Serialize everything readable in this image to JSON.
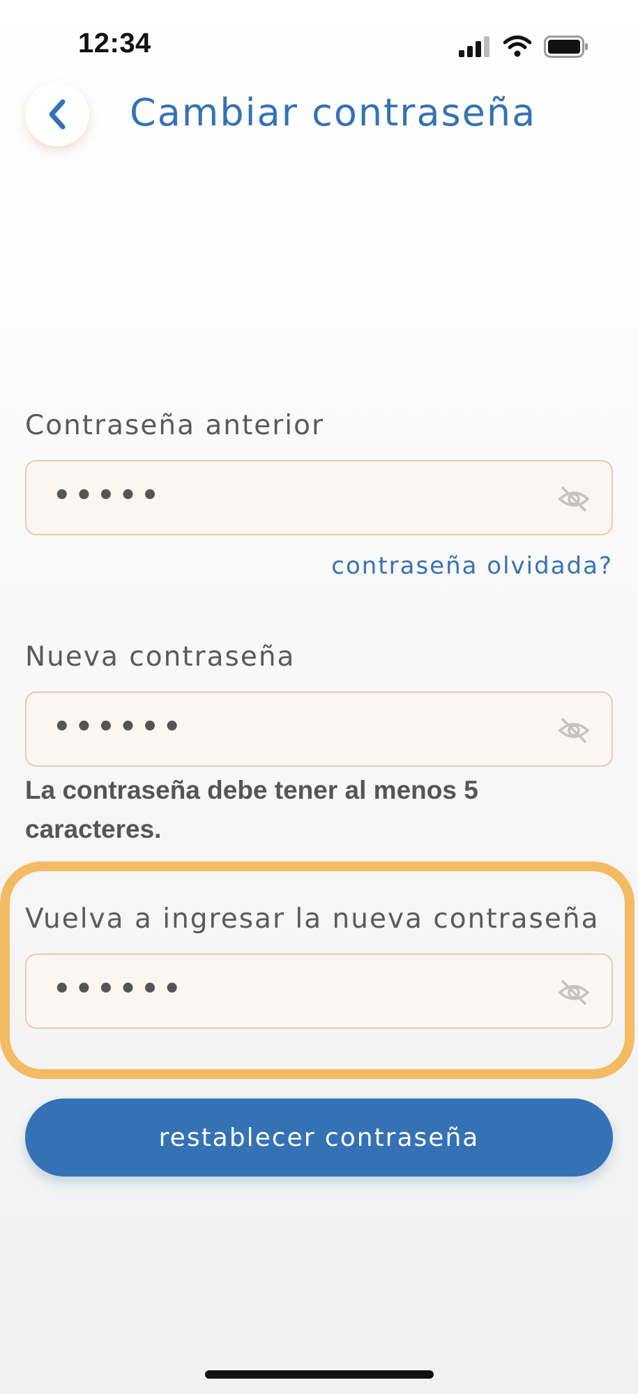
{
  "status_bar": {
    "time": "12:34",
    "icons": [
      "cellular-signal-icon",
      "wifi-icon",
      "battery-icon"
    ]
  },
  "header": {
    "back_icon": "chevron-left-icon",
    "title": "Cambiar contraseña"
  },
  "form": {
    "old_password": {
      "label": "Contraseña anterior",
      "value_masked": "•••••",
      "visibility_icon": "eye-slash-icon"
    },
    "forgot_link": "contraseña olvidada?",
    "new_password": {
      "label": "Nueva contraseña",
      "value_masked": "••••••",
      "visibility_icon": "eye-slash-icon"
    },
    "hint": "La contraseña debe tener al menos 5 caracteres.",
    "confirm_password": {
      "label": "Vuelva a ingresar la nueva contraseña",
      "value_masked": "••••••",
      "visibility_icon": "eye-slash-icon"
    },
    "submit_label": "restablecer contraseña"
  },
  "colors": {
    "accent": "#3572b5",
    "highlight": "#f3bb62",
    "field_bg": "#fbf6ef",
    "field_border": "#e1cdb2",
    "label_text": "#5a5a5a"
  }
}
